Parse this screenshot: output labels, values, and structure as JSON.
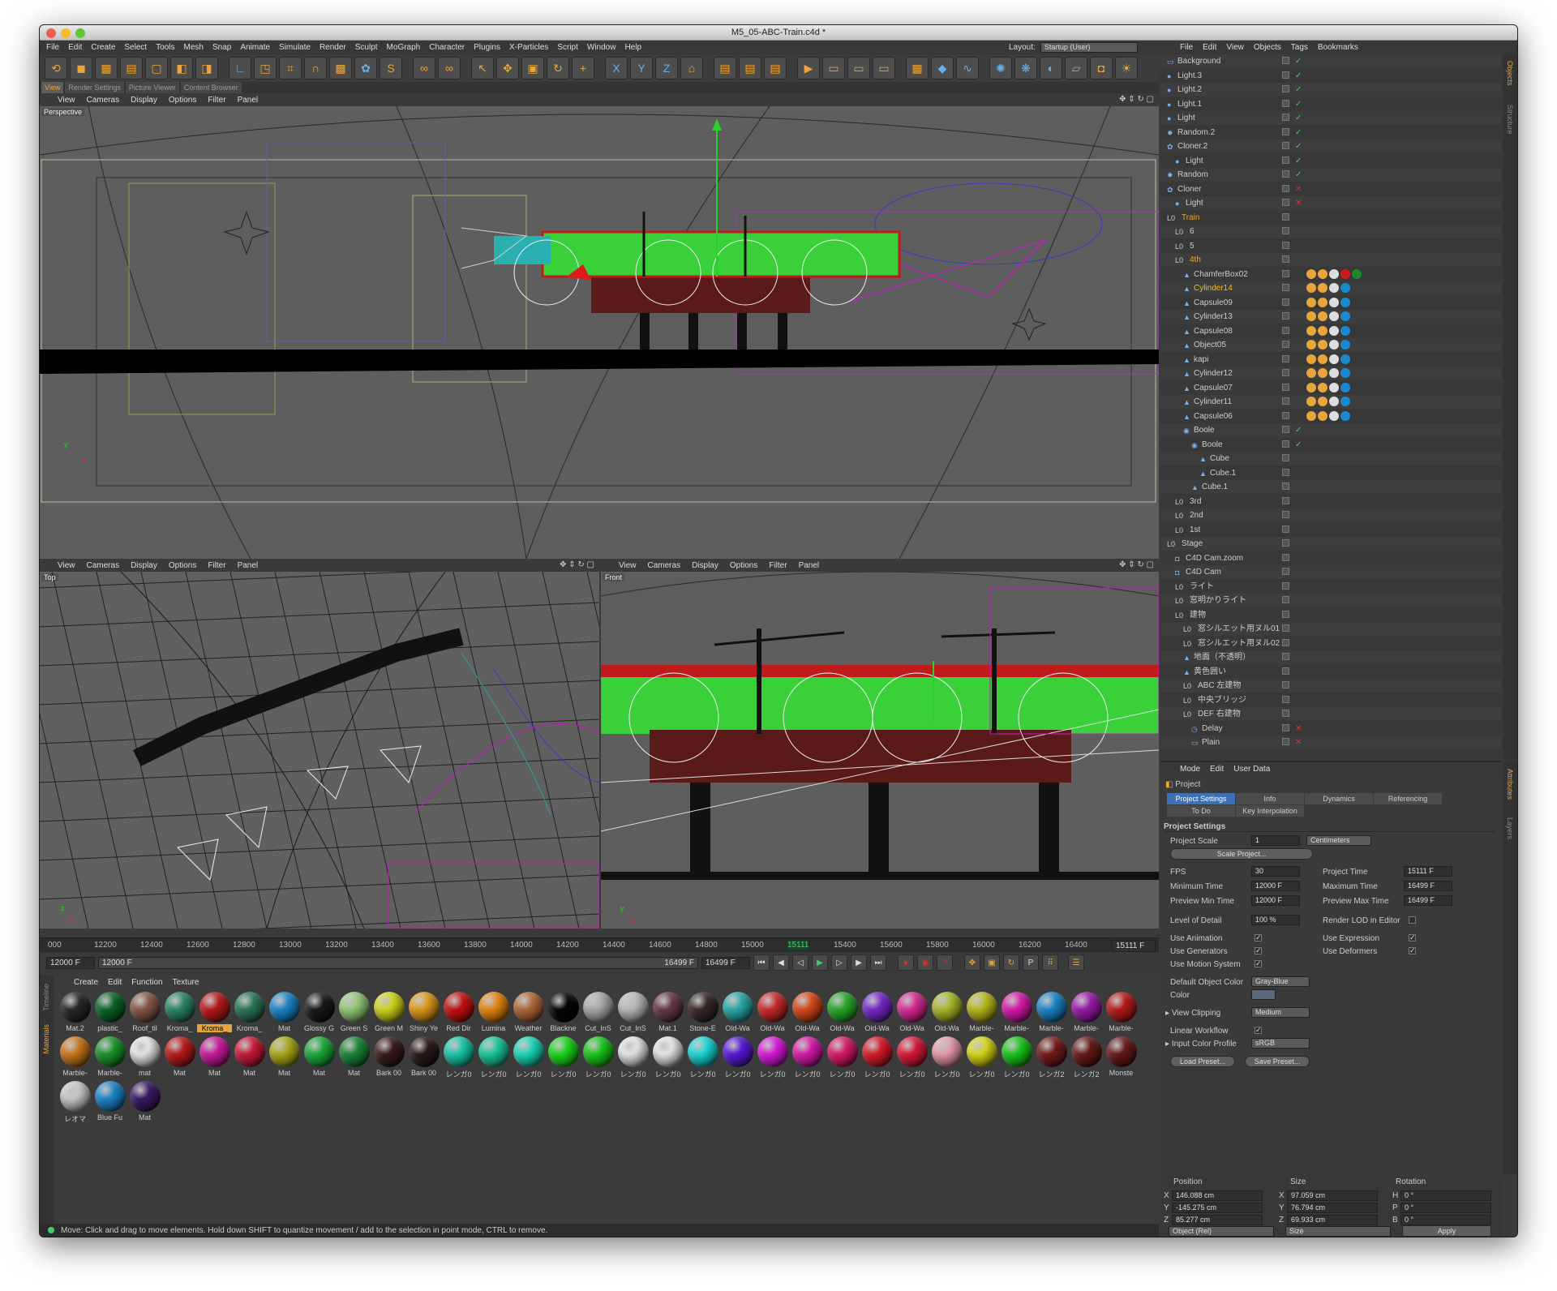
{
  "window": {
    "title": "M5_05-ABC-Train.c4d *"
  },
  "menu": [
    "File",
    "Edit",
    "Create",
    "Select",
    "Tools",
    "Mesh",
    "Snap",
    "Animate",
    "Simulate",
    "Render",
    "Sculpt",
    "MoGraph",
    "Character",
    "Plugins",
    "X-Particles",
    "Script",
    "Window",
    "Help"
  ],
  "layout": {
    "label": "Layout:",
    "value": "Startup (User)"
  },
  "toolbar_icons": [
    "undo-icon",
    "cube-icon",
    "checker-icon",
    "grid-icon",
    "box-outline-icon",
    "box-icon",
    "box-orange-icon",
    "axis-icon",
    "render-region-icon",
    "crop-icon",
    "magnet-icon",
    "texture-icon",
    "deformer-icon",
    "s-plugin-icon",
    "link-icon",
    "link2-icon",
    "select-icon",
    "move-icon",
    "scale-icon",
    "rotate-icon",
    "add-icon",
    "x-axis-icon",
    "y-axis-icon",
    "z-axis-icon",
    "coord-icon",
    "film-icon",
    "film2-icon",
    "film3-icon",
    "play-icon",
    "render-view-icon",
    "render-pic-icon",
    "render-settings-icon",
    "render-queue-icon",
    "cube-blue-icon",
    "spline-icon",
    "nurbs-icon",
    "array-icon",
    "deform-icon",
    "floor-icon",
    "camera-icon",
    "light-icon"
  ],
  "view_tabs": [
    "View",
    "Render Settings",
    "Picture Viewer",
    "Content Browser"
  ],
  "viewport_menu": [
    "View",
    "Cameras",
    "Display",
    "Options",
    "Filter",
    "Panel"
  ],
  "viewports": {
    "perspective": "Perspective",
    "top": "Top",
    "front": "Front"
  },
  "timeline": {
    "ticks": [
      "000",
      "12200",
      "12400",
      "12600",
      "12800",
      "13000",
      "13200",
      "13400",
      "13600",
      "13800",
      "14000",
      "14200",
      "14400",
      "14600",
      "14800",
      "15000",
      "15111",
      "15400",
      "15600",
      "15800",
      "16000",
      "16200",
      "16400"
    ],
    "current": "15111 F"
  },
  "playbar": {
    "start": "12000 F",
    "range_start": "12000 F",
    "range_end": "16499 F",
    "end": "16499 F"
  },
  "materials": {
    "menu": [
      "Create",
      "Edit",
      "Function",
      "Texture"
    ],
    "side_tabs": [
      "Timeline",
      "Materials"
    ],
    "items": [
      {
        "name": "Mat.2",
        "color": "#2a2a2a"
      },
      {
        "name": "plastic_",
        "color": "#0a6a2a"
      },
      {
        "name": "Roof_til",
        "color": "#8a5a4a"
      },
      {
        "name": "Kroma_",
        "color": "#2a8a6a"
      },
      {
        "name": "Kroma_",
        "color": "#c01a1a"
      },
      {
        "name": "Kroma_",
        "color": "#2a7a5a"
      },
      {
        "name": "Mat",
        "color": "#1a8ad0"
      },
      {
        "name": "Glossy G",
        "color": "#1a1a1a"
      },
      {
        "name": "Green S",
        "color": "#9ad07a"
      },
      {
        "name": "Green M",
        "color": "#d8e01a"
      },
      {
        "name": "Shiny Ye",
        "color": "#e8a01a"
      },
      {
        "name": "Red Dir",
        "color": "#d01010"
      },
      {
        "name": "Lumina",
        "color": "#f08a10"
      },
      {
        "name": "Weather",
        "color": "#b86a3a"
      },
      {
        "name": "Blackne",
        "color": "#050505"
      },
      {
        "name": "Cut_InS",
        "color": "#b0b0b0"
      },
      {
        "name": "Cut_InS",
        "color": "#c0c0c0"
      },
      {
        "name": "Mat.1",
        "color": "#6a3a4a"
      },
      {
        "name": "Stone-E",
        "color": "#3a2a2a"
      },
      {
        "name": "Old-Wa",
        "color": "#2ab0b0"
      },
      {
        "name": "Old-Wa",
        "color": "#d02a2a"
      },
      {
        "name": "Old-Wa",
        "color": "#e04a1a"
      },
      {
        "name": "Old-Wa",
        "color": "#2ab02a"
      },
      {
        "name": "Old-Wa",
        "color": "#7a2ad0"
      },
      {
        "name": "Old-Wa",
        "color": "#e02a9a"
      },
      {
        "name": "Old-Wa",
        "color": "#b0c02a"
      },
      {
        "name": "Marble-",
        "color": "#c0c01a"
      },
      {
        "name": "Marble-",
        "color": "#e01ab0"
      },
      {
        "name": "Marble-",
        "color": "#1a8ad0"
      },
      {
        "name": "Marble-",
        "color": "#a01ab0"
      },
      {
        "name": "Marble-",
        "color": "#c01a1a"
      },
      {
        "name": "Marble-",
        "color": "#d07a1a"
      },
      {
        "name": "Marble-",
        "color": "#1a9a2a"
      },
      {
        "name": "mat",
        "color": "#f0f0f0"
      },
      {
        "name": "Mat",
        "color": "#c01a1a"
      },
      {
        "name": "Mat",
        "color": "#d01aa0"
      },
      {
        "name": "Mat",
        "color": "#d01a3a"
      },
      {
        "name": "Mat",
        "color": "#b0b01a"
      },
      {
        "name": "Mat",
        "color": "#1ab03a"
      },
      {
        "name": "Mat",
        "color": "#1a8a3a"
      },
      {
        "name": "Bark 00",
        "color": "#3a1a1a"
      },
      {
        "name": "Bark 00",
        "color": "#2a1a1a"
      },
      {
        "name": "レンガ0",
        "color": "#1ad0b0"
      },
      {
        "name": "レンガ0",
        "color": "#1ad0a0"
      },
      {
        "name": "レンガ0",
        "color": "#1ae0c0"
      },
      {
        "name": "レンガ0",
        "color": "#1ae01a"
      },
      {
        "name": "レンガ0",
        "color": "#1ad01a"
      },
      {
        "name": "レンガ0",
        "color": "#f0f0f0"
      },
      {
        "name": "レンガ0",
        "color": "#f0f0f0"
      },
      {
        "name": "レンガ0",
        "color": "#1ae0e0"
      },
      {
        "name": "レンガ0",
        "color": "#5a1ae0"
      },
      {
        "name": "レンガ0",
        "color": "#e01ae0"
      },
      {
        "name": "レンガ0",
        "color": "#e01ab0"
      },
      {
        "name": "レンガ0",
        "color": "#e01a6a"
      },
      {
        "name": "レンガ0",
        "color": "#e01a2a"
      },
      {
        "name": "レンガ0",
        "color": "#e01a3a"
      },
      {
        "name": "レンガ0",
        "color": "#f0a0b0"
      },
      {
        "name": "レンガ0",
        "color": "#e0e01a"
      },
      {
        "name": "レンガ0",
        "color": "#1ad01a"
      },
      {
        "name": "レンガ2",
        "color": "#7a1a1a"
      },
      {
        "name": "レンガ2",
        "color": "#6a1a1a"
      },
      {
        "name": "Monste",
        "color": "#6a1a1a"
      },
      {
        "name": "レオマ",
        "color": "#d0d0d0"
      },
      {
        "name": "Blue Fu",
        "color": "#1a8ad0"
      },
      {
        "name": "Mat",
        "color": "#3a1a6a"
      }
    ]
  },
  "status": "Move: Click and drag to move elements. Hold down SHIFT to quantize movement / add to the selection in point mode, CTRL to remove.",
  "objects": {
    "menu": [
      "File",
      "Edit",
      "View",
      "Objects",
      "Tags",
      "Bookmarks"
    ],
    "side_tabs": [
      "Objects",
      "Structure"
    ],
    "rows": [
      {
        "name": "Background",
        "depth": 0,
        "icon": "background-icon",
        "status": "ok"
      },
      {
        "name": "Light.3",
        "depth": 0,
        "icon": "light-icon",
        "status": "ok"
      },
      {
        "name": "Light.2",
        "depth": 0,
        "icon": "light-icon",
        "status": "ok"
      },
      {
        "name": "Light.1",
        "depth": 0,
        "icon": "light-icon",
        "status": "ok"
      },
      {
        "name": "Light",
        "depth": 0,
        "icon": "light-icon",
        "status": "ok"
      },
      {
        "name": "Random.2",
        "depth": 0,
        "icon": "random-icon",
        "status": "ok"
      },
      {
        "name": "Cloner.2",
        "depth": 0,
        "icon": "cloner-icon",
        "status": "ok"
      },
      {
        "name": "Light",
        "depth": 1,
        "icon": "light-icon",
        "status": "ok"
      },
      {
        "name": "Random",
        "depth": 0,
        "icon": "random-icon",
        "status": "ok"
      },
      {
        "name": "Cloner",
        "depth": 0,
        "icon": "cloner-icon",
        "status": "off"
      },
      {
        "name": "Light",
        "depth": 1,
        "icon": "light-icon",
        "status": "off"
      },
      {
        "name": "Train",
        "depth": 0,
        "icon": "null-icon",
        "status": "",
        "highlight": "orange"
      },
      {
        "name": "6",
        "depth": 1,
        "icon": "null-icon",
        "status": ""
      },
      {
        "name": "5",
        "depth": 1,
        "icon": "null-icon",
        "status": ""
      },
      {
        "name": "4th",
        "depth": 1,
        "icon": "null-icon",
        "status": "",
        "highlight": "orange"
      },
      {
        "name": "ChamferBox02",
        "depth": 2,
        "icon": "polygon-icon",
        "status": ""
      },
      {
        "name": "Cylinder14",
        "depth": 2,
        "icon": "polygon-icon",
        "status": "",
        "highlight": "yellow"
      },
      {
        "name": "Capsule09",
        "depth": 2,
        "icon": "polygon-icon",
        "status": ""
      },
      {
        "name": "Cylinder13",
        "depth": 2,
        "icon": "polygon-icon",
        "status": ""
      },
      {
        "name": "Capsule08",
        "depth": 2,
        "icon": "polygon-icon",
        "status": ""
      },
      {
        "name": "Object05",
        "depth": 2,
        "icon": "polygon-icon",
        "status": ""
      },
      {
        "name": "kapi",
        "depth": 2,
        "icon": "polygon-icon",
        "status": ""
      },
      {
        "name": "Cylinder12",
        "depth": 2,
        "icon": "polygon-icon",
        "status": ""
      },
      {
        "name": "Capsule07",
        "depth": 2,
        "icon": "polygon-icon",
        "status": ""
      },
      {
        "name": "Cylinder11",
        "depth": 2,
        "icon": "polygon-icon",
        "status": ""
      },
      {
        "name": "Capsule06",
        "depth": 2,
        "icon": "polygon-icon",
        "status": ""
      },
      {
        "name": "Boole",
        "depth": 2,
        "icon": "boole-icon",
        "status": "ok"
      },
      {
        "name": "Boole",
        "depth": 3,
        "icon": "boole-icon",
        "status": "ok"
      },
      {
        "name": "Cube",
        "depth": 4,
        "icon": "polygon-icon",
        "status": ""
      },
      {
        "name": "Cube.1",
        "depth": 4,
        "icon": "polygon-icon",
        "status": ""
      },
      {
        "name": "Cube.1",
        "depth": 3,
        "icon": "polygon-icon",
        "status": ""
      },
      {
        "name": "3rd",
        "depth": 1,
        "icon": "null-icon",
        "status": ""
      },
      {
        "name": "2nd",
        "depth": 1,
        "icon": "null-icon",
        "status": ""
      },
      {
        "name": "1st",
        "depth": 1,
        "icon": "null-icon",
        "status": ""
      },
      {
        "name": "Stage",
        "depth": 0,
        "icon": "null-icon",
        "status": ""
      },
      {
        "name": "C4D Cam.zoom",
        "depth": 1,
        "icon": "camera-icon",
        "status": ""
      },
      {
        "name": "C4D Cam",
        "depth": 1,
        "icon": "camera-icon",
        "status": ""
      },
      {
        "name": "ライト",
        "depth": 1,
        "icon": "null-icon",
        "status": ""
      },
      {
        "name": "窓明かりライト",
        "depth": 1,
        "icon": "null-icon",
        "status": ""
      },
      {
        "name": "建物",
        "depth": 1,
        "icon": "null-icon",
        "status": ""
      },
      {
        "name": "窓シルエット用ヌル01",
        "depth": 2,
        "icon": "null-icon",
        "status": ""
      },
      {
        "name": "窓シルエット用ヌル02",
        "depth": 2,
        "icon": "null-icon",
        "status": ""
      },
      {
        "name": "地面（不透明）",
        "depth": 2,
        "icon": "polygon-icon",
        "status": ""
      },
      {
        "name": "黄色囲い",
        "depth": 2,
        "icon": "polygon-icon",
        "status": ""
      },
      {
        "name": "ABC 左建物",
        "depth": 2,
        "icon": "null-icon",
        "status": ""
      },
      {
        "name": "中央ブリッジ",
        "depth": 2,
        "icon": "null-icon",
        "status": ""
      },
      {
        "name": "DEF 右建物",
        "depth": 2,
        "icon": "null-icon",
        "status": ""
      },
      {
        "name": "Delay",
        "depth": 3,
        "icon": "delay-icon",
        "status": "off"
      },
      {
        "name": "Plain",
        "depth": 3,
        "icon": "plain-icon",
        "status": "off"
      }
    ]
  },
  "attributes": {
    "menu": [
      "Mode",
      "Edit",
      "User Data"
    ],
    "side_tabs": [
      "Attributes",
      "Layers"
    ],
    "object": "Project",
    "tabs_row1": [
      "Project Settings",
      "Info",
      "Dynamics",
      "Referencing"
    ],
    "tabs_row2": [
      "To Do",
      "Key Interpolation"
    ],
    "section": "Project Settings",
    "project_scale_label": "Project Scale",
    "project_scale": "1",
    "project_scale_unit": "Centimeters",
    "scale_btn": "Scale Project...",
    "fps_label": "FPS",
    "fps": "30",
    "project_time_label": "Project Time",
    "project_time": "15111 F",
    "min_time_label": "Minimum Time",
    "min_time": "12000 F",
    "max_time_label": "Maximum Time",
    "max_time": "16499 F",
    "prev_min_label": "Preview Min Time",
    "prev_min": "12000 F",
    "prev_max_label": "Preview Max Time",
    "prev_max": "16499 F",
    "lod_label": "Level of Detail",
    "lod": "100 %",
    "render_lod_label": "Render LOD in Editor",
    "use_anim_label": "Use Animation",
    "use_expr_label": "Use Expression",
    "use_gen_label": "Use Generators",
    "use_def_label": "Use Deformers",
    "use_motion_label": "Use Motion System",
    "def_color_label": "Default Object Color",
    "def_color": "Gray-Blue",
    "color_label": "Color",
    "view_clip_label": "View Clipping",
    "view_clip": "Medium",
    "linear_label": "Linear Workflow",
    "icp_label": "Input Color Profile",
    "icp": "sRGB",
    "load_preset": "Load Preset...",
    "save_preset": "Save Preset..."
  },
  "coords": {
    "headers": [
      "Position",
      "Size",
      "Rotation"
    ],
    "rows": [
      {
        "axis": "X",
        "pos": "146.088 cm",
        "size_axis": "X",
        "size": "97.059 cm",
        "rot_axis": "H",
        "rot": "0 °"
      },
      {
        "axis": "Y",
        "pos": "-145.275 cm",
        "size_axis": "Y",
        "size": "76.794 cm",
        "rot_axis": "P",
        "rot": "0 °"
      },
      {
        "axis": "Z",
        "pos": "85.277 cm",
        "size_axis": "Z",
        "size": "69.933 cm",
        "rot_axis": "B",
        "rot": "0 °"
      }
    ],
    "mode1": "Object (Rel)",
    "mode2": "Size",
    "apply": "Apply"
  }
}
